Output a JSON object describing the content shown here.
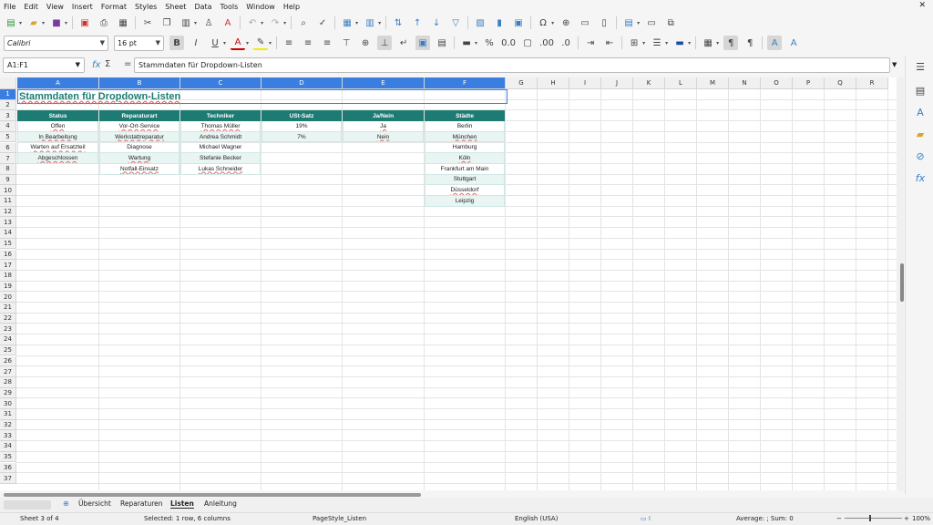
{
  "menu": [
    "File",
    "Edit",
    "View",
    "Insert",
    "Format",
    "Styles",
    "Sheet",
    "Data",
    "Tools",
    "Window",
    "Help"
  ],
  "font": {
    "name": "Calibri",
    "size": "16 pt"
  },
  "name_box": "A1:F1",
  "formula": "Stammdaten für Dropdown-Listen",
  "columns": [
    "A",
    "B",
    "C",
    "D",
    "E",
    "F",
    "G",
    "H",
    "I",
    "J",
    "K",
    "L",
    "M",
    "N",
    "O",
    "P",
    "Q",
    "R"
  ],
  "rows": [
    "1",
    "2",
    "3",
    "4",
    "5",
    "6",
    "7",
    "8",
    "9",
    "10",
    "11",
    "12",
    "13",
    "14",
    "15",
    "16",
    "17",
    "18",
    "19",
    "20",
    "21",
    "22",
    "23",
    "24",
    "25",
    "26",
    "27",
    "28",
    "29",
    "30",
    "31",
    "32",
    "33",
    "34",
    "35",
    "36",
    "37"
  ],
  "sheet": {
    "title": "Stammdaten für Dropdown-Listen",
    "headers": [
      "Status",
      "Reparaturart",
      "Techniker",
      "USt-Satz",
      "Ja/Nein",
      "Städte"
    ],
    "status": [
      "Offen",
      "In Bearbeitung",
      "Warten auf Ersatzteil",
      "Abgeschlossen"
    ],
    "reparaturart": [
      "Vor-Ort-Service",
      "Werkstattreparatur",
      "Diagnose",
      "Wartung",
      "Notfall-Einsatz"
    ],
    "techniker": [
      "Thomas Müller",
      "Andrea Schmidt",
      "Michael Wagner",
      "Stefanie Becker",
      "Lukas Schneider"
    ],
    "ust": [
      "19%",
      "7%"
    ],
    "janein": [
      "Ja",
      "Nein"
    ],
    "staedte": [
      "Berlin",
      "München",
      "Hamburg",
      "Köln",
      "Frankfurt am Main",
      "Stuttgart",
      "Düsseldorf",
      "Leipzig"
    ]
  },
  "tabs": [
    "Übersicht",
    "Reparaturen",
    "Listen",
    "Anleitung"
  ],
  "active_tab": "Listen",
  "status": {
    "sheet": "Sheet 3 of 4",
    "selection": "Selected: 1 row, 6 columns",
    "pagestyle": "PageStyle_Listen",
    "language": "English (USA)",
    "sum": "Average: ; Sum: 0",
    "zoom": "100%"
  }
}
